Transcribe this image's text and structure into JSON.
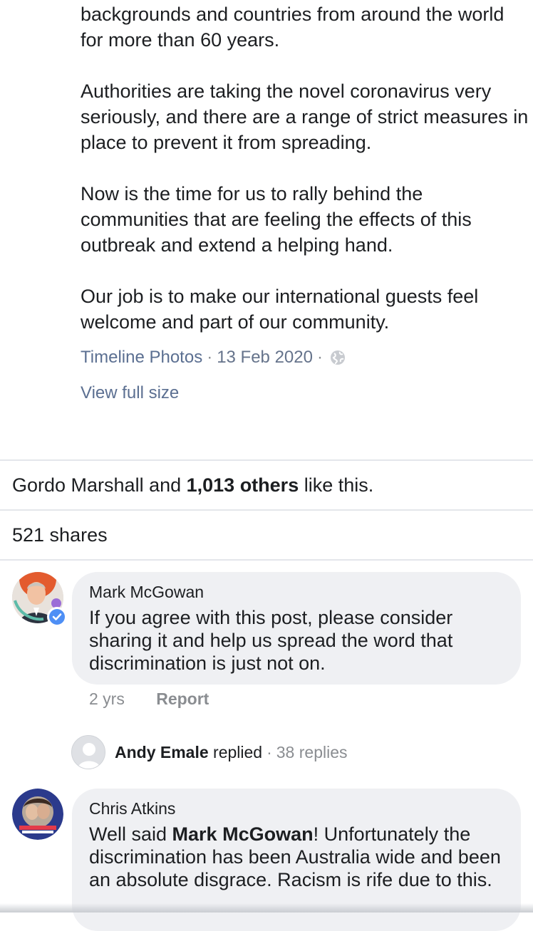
{
  "post": {
    "paragraphs": [
      "backgrounds and countries from around the world for more than 60 years.",
      "Authorities are taking the novel coronavirus very seriously, and there are a range of strict measures in place to prevent it from spreading.",
      "Now is the time for us to rally behind the communities that are feeling the effects of this outbreak and extend a helping hand.",
      "Our job is to make our international guests feel welcome and part of our community."
    ],
    "album_link": "Timeline Photos",
    "date": "13 Feb 2020",
    "separator": "·",
    "privacy_icon": "globe-icon",
    "view_full_size": "View full size"
  },
  "reactions": {
    "likes_prefix": "Gordo Marshall and ",
    "likes_bold": "1,013 others",
    "likes_suffix": " like this.",
    "shares": "521 shares"
  },
  "comments": [
    {
      "author": "Mark McGowan",
      "verified": true,
      "text": "If you agree with this post, please consider sharing it and help us spread the word that discrimination is just not on.",
      "time": "2 yrs",
      "report_label": "Report",
      "reply_summary": {
        "author": "Andy Emale",
        "action": " replied",
        "separator": "·",
        "count": "38 replies"
      }
    },
    {
      "author": "Chris Atkins",
      "text_prefix": "Well said ",
      "text_bold": "Mark McGowan",
      "text_suffix": "! Unfortunately the discrimination has been Australia wide and been an absolute disgrace. Racism is rife due to this."
    }
  ],
  "colors": {
    "link": "#5b6f91",
    "muted": "#8a8d91",
    "bubble": "#eff0f3",
    "verified": "#4e8ff5"
  }
}
